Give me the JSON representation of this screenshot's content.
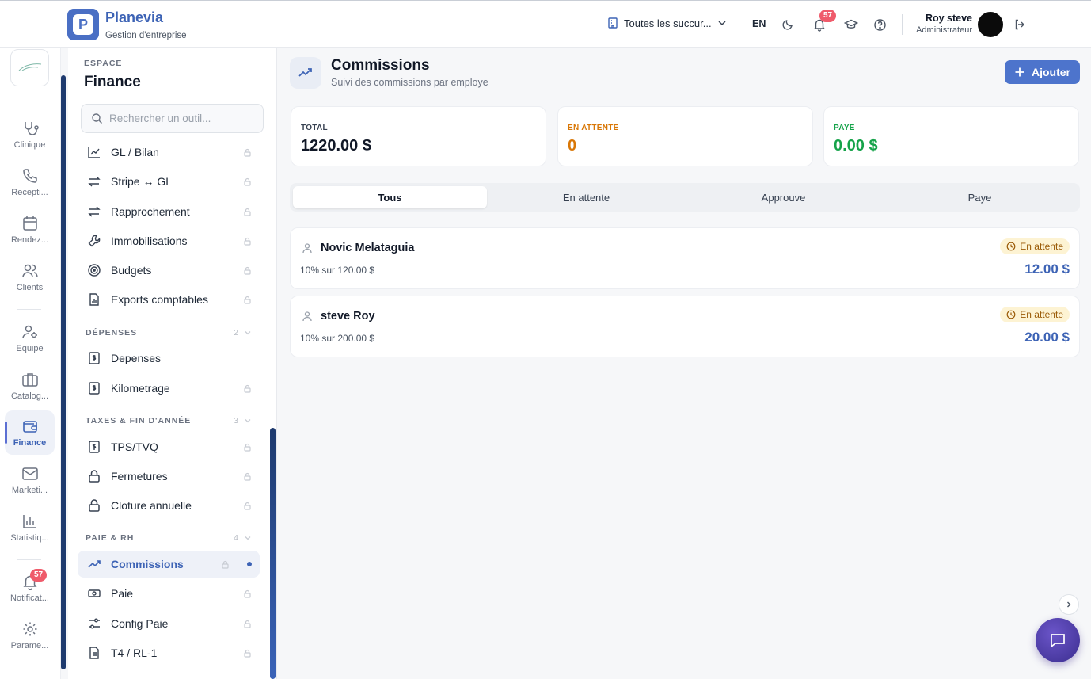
{
  "header": {
    "brand_name": "Planevia",
    "brand_sub": "Gestion d'entreprise",
    "branch": "Toutes les succur...",
    "language": "EN",
    "notifications_count": "57",
    "user_name": "Roy steve",
    "user_role": "Administrateur"
  },
  "rail": {
    "items": [
      {
        "label": "Clinique",
        "icon": "stethoscope-icon"
      },
      {
        "label": "Recepti...",
        "icon": "phone-icon"
      },
      {
        "label": "Rendez...",
        "icon": "calendar-icon"
      },
      {
        "label": "Clients",
        "icon": "users-icon"
      },
      {
        "label": "Equipe",
        "icon": "user-cog-icon"
      },
      {
        "label": "Catalog...",
        "icon": "briefcase-icon"
      },
      {
        "label": "Finance",
        "icon": "wallet-icon"
      },
      {
        "label": "Marketi...",
        "icon": "mail-icon"
      },
      {
        "label": "Statistiq...",
        "icon": "bar-chart-icon"
      },
      {
        "label": "Notificat...",
        "icon": "bell-icon",
        "badge": "57"
      },
      {
        "label": "Parame...",
        "icon": "gear-icon"
      }
    ]
  },
  "sidebar": {
    "eyebrow": "ESPACE",
    "title": "Finance",
    "search_placeholder": "Rechercher un outil...",
    "items_top": [
      {
        "label": "GL / Bilan",
        "icon": "line-chart-icon"
      },
      {
        "label": "Stripe ↔ GL",
        "icon": "arrows-icon"
      },
      {
        "label": "Rapprochement",
        "icon": "arrows-icon"
      },
      {
        "label": "Immobilisations",
        "icon": "wrench-icon"
      },
      {
        "label": "Budgets",
        "icon": "target-icon"
      },
      {
        "label": "Exports comptables",
        "icon": "file-chart-icon"
      }
    ],
    "groups": [
      {
        "label": "DÉPENSES",
        "count": "2",
        "items": [
          {
            "label": "Depenses",
            "icon": "receipt-icon"
          },
          {
            "label": "Kilometrage",
            "icon": "receipt-icon"
          }
        ]
      },
      {
        "label": "TAXES & FIN D'ANNÉE",
        "count": "3",
        "items": [
          {
            "label": "TPS/TVQ",
            "icon": "receipt-icon"
          },
          {
            "label": "Fermetures",
            "icon": "lock-icon"
          },
          {
            "label": "Cloture annuelle",
            "icon": "lock-icon"
          }
        ]
      },
      {
        "label": "PAIE & RH",
        "count": "4",
        "items": [
          {
            "label": "Commissions",
            "icon": "trend-icon"
          },
          {
            "label": "Paie",
            "icon": "banknote-icon"
          },
          {
            "label": "Config Paie",
            "icon": "sliders-icon"
          },
          {
            "label": "T4 / RL-1",
            "icon": "file-icon"
          }
        ]
      }
    ]
  },
  "page": {
    "title": "Commissions",
    "subtitle": "Suivi des commissions par employe",
    "add_label": "Ajouter",
    "stats": [
      {
        "label": "TOTAL",
        "value": "1220.00 $",
        "color": "#111827"
      },
      {
        "label": "EN ATTENTE",
        "value": "0",
        "color": "#d97706"
      },
      {
        "label": "PAYE",
        "value": "0.00 $",
        "color": "#16a34a"
      }
    ],
    "tabs": [
      "Tous",
      "En attente",
      "Approuve",
      "Paye"
    ],
    "active_tab": "Tous",
    "commissions": [
      {
        "name": "Novic Melataguia",
        "detail": "10% sur 120.00 $",
        "status": "En attente",
        "amount": "12.00 $"
      },
      {
        "name": "steve Roy",
        "detail": "10% sur 200.00 $",
        "status": "En attente",
        "amount": "20.00 $"
      }
    ]
  },
  "colors": {
    "accent": "#3d63b5",
    "button": "#4d74cc",
    "pending_bg": "#fdf3d3",
    "pending_text": "#9a5a06",
    "badge": "#ef5b6b"
  }
}
